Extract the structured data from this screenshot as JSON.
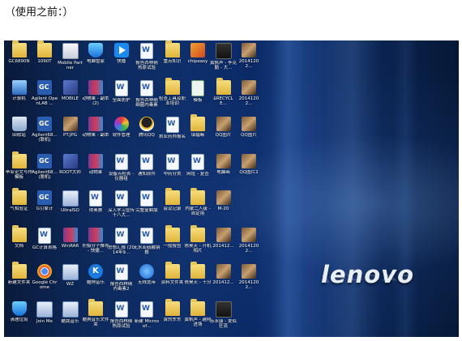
{
  "caption": "（使用之前：）",
  "brand_logo": "lenovo",
  "colors": {
    "desktop_bg": "#0d2a5e",
    "label_text": "#ffffff"
  },
  "columns": [
    [
      {
        "label": "GC6890N",
        "icon": "folder-icon"
      },
      {
        "label": "计算机",
        "icon": "computer-icon"
      },
      {
        "label": "回收站",
        "icon": "recycle-bin-icon"
      },
      {
        "label": "毕业论文写作模板",
        "icon": "folder-icon"
      },
      {
        "label": "气相验证",
        "icon": "folder-icon"
      },
      {
        "label": "文档",
        "icon": "folder-icon"
      },
      {
        "label": "新建文件夹",
        "icon": "folder-icon"
      },
      {
        "label": "清理垃圾",
        "icon": "shield-icon"
      }
    ],
    [
      {
        "label": "1090T",
        "icon": "folder-icon"
      },
      {
        "label": "Agilent OpenLAB ...",
        "icon": "gc-icon"
      },
      {
        "label": "Agilent68... (联机)",
        "icon": "gc-icon"
      },
      {
        "label": "Agilent68... (脱机)",
        "icon": "gc-icon"
      },
      {
        "label": "G引擎计",
        "icon": "gc-icon"
      },
      {
        "label": "GC计算表格",
        "icon": "document-icon"
      },
      {
        "label": "Google Chrome",
        "icon": "chrome-icon"
      },
      {
        "label": "Join Me",
        "icon": "exe-icon"
      }
    ],
    [
      {
        "label": "Mobile Partner",
        "icon": "mobile-icon"
      },
      {
        "label": "MOBILE",
        "icon": "tool-icon"
      },
      {
        "label": "PT.JPG",
        "icon": "photo-icon"
      },
      {
        "label": "ROOT大师",
        "icon": "tool-icon"
      },
      {
        "label": "UltraISO",
        "icon": "exe-icon"
      },
      {
        "label": "WinRAR",
        "icon": "winrar-icon"
      },
      {
        "label": "WZ",
        "icon": "exe-icon"
      },
      {
        "label": "酷我音乐",
        "icon": "exe-icon"
      }
    ],
    [
      {
        "label": "电脑管家",
        "icon": "shield-icon"
      },
      {
        "label": "动物果 - 副本 (2)",
        "icon": "winrar-icon"
      },
      {
        "label": "动物果 - 副本",
        "icon": "winrar-icon"
      },
      {
        "label": "动物果",
        "icon": "winrar-icon"
      },
      {
        "label": "得奥赛",
        "icon": "document-icon"
      },
      {
        "label": "积极分子推荐 - 快捷...",
        "icon": "winrar-icon"
      },
      {
        "label": "酷狗音乐",
        "icon": "kugou-icon"
      },
      {
        "label": "酷狗音乐文件夹",
        "icon": "folder-icon"
      }
    ],
    [
      {
        "label": "快播",
        "icon": "play-icon"
      },
      {
        "label": "全面防护",
        "icon": "document-icon"
      },
      {
        "label": "软件管理",
        "icon": "color-icon"
      },
      {
        "label": "设备点检表 - 仪器组",
        "icon": "document-icon"
      },
      {
        "label": "深入学习宣传十八大...",
        "icon": "document-icon"
      },
      {
        "label": "思想汇报 (2014年9...",
        "icon": "document-icon"
      },
      {
        "label": "报告西林纳 内毒素2",
        "icon": "document-icon"
      },
      {
        "label": "报告西林纳 热原试验",
        "icon": "document-icon"
      }
    ],
    [
      {
        "label": "报告西林纳 热原试验",
        "icon": "document-icon"
      },
      {
        "label": "报告西林纳 细菌内毒素",
        "icon": "document-icon"
      },
      {
        "label": "腾讯QQ",
        "icon": "qq-icon"
      },
      {
        "label": "通知原件",
        "icon": "document-icon"
      },
      {
        "label": "完整复制版",
        "icon": "document-icon"
      },
      {
        "label": "无水亚硫酸钠报",
        "icon": "document-icon"
      },
      {
        "label": "无线宽带",
        "icon": "ie-icon"
      },
      {
        "label": "新建 Microsof...",
        "icon": "document-icon"
      }
    ],
    [
      {
        "label": "重点知识",
        "icon": "folder-icon"
      },
      {
        "label": "检查工具及职业培训",
        "icon": "folder-icon"
      },
      {
        "label": "执业药师报名",
        "icon": "document-icon"
      },
      {
        "label": "中药分类",
        "icon": "document-icon"
      },
      {
        "label": "会议记录",
        "icon": "folder-icon"
      },
      {
        "label": "一般报告",
        "icon": "folder-icon"
      },
      {
        "label": "资料文件夹",
        "icon": "folder-icon"
      },
      {
        "label": "寅的东东",
        "icon": "folder-icon"
      }
    ],
    [
      {
        "label": "chipeasy",
        "icon": "chip-icon"
      },
      {
        "label": "模板",
        "icon": "sheet-icon"
      },
      {
        "label": "填福嘛",
        "icon": "folder-icon"
      },
      {
        "label": "网址 - 复查",
        "icon": "document-icon"
      },
      {
        "label": "内蒙二人级 - 自定用",
        "icon": "folder-icon"
      },
      {
        "label": "陈昊天 - 开机相片",
        "icon": "folder-icon"
      },
      {
        "label": "陈昊天 - 十分",
        "icon": "folder-icon"
      },
      {
        "label": "黄帆声 - 越翔进场",
        "icon": "folder-icon"
      }
    ],
    [
      {
        "label": "黄帆声 - 李克勤 - 大...",
        "icon": "video-icon"
      },
      {
        "label": "$RECYCLE...",
        "icon": "folder-icon"
      },
      {
        "label": "QQ图片",
        "icon": "photo-icon"
      },
      {
        "label": "电脑画",
        "icon": "photo-icon"
      },
      {
        "label": "M-20",
        "icon": "photo-icon"
      },
      {
        "label": "201412...",
        "icon": "photo-icon"
      },
      {
        "label": "201412...",
        "icon": "photo-icon"
      },
      {
        "label": "苏永康 - 爱似狂流",
        "icon": "video-icon"
      }
    ],
    [
      {
        "label": "20141202...",
        "icon": "photo-icon"
      },
      {
        "label": "20141202...",
        "icon": "photo-icon"
      },
      {
        "label": "QQ图片",
        "icon": "photo-icon"
      },
      {
        "label": "QQ图片2",
        "icon": "photo-icon"
      },
      {
        "label": "",
        "icon": ""
      },
      {
        "label": "20141202...",
        "icon": "photo-icon"
      },
      {
        "label": "20141202...",
        "icon": "photo-icon"
      },
      {
        "label": "",
        "icon": ""
      }
    ]
  ]
}
